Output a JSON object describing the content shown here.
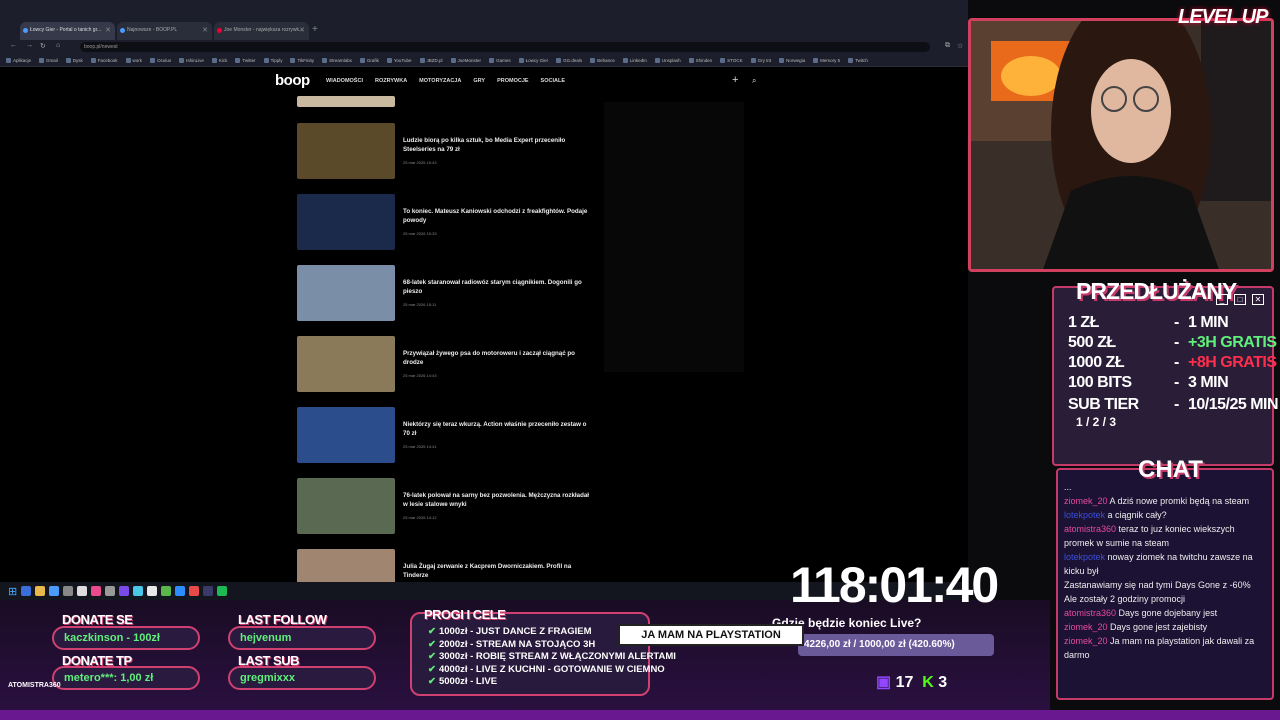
{
  "browser": {
    "tabs": [
      {
        "label": "Łowcy Gier - Portal o tanich gr..."
      },
      {
        "label": "Najnowsze - BOOP.PL"
      },
      {
        "label": "Joe Monster - największa rozrywk..."
      }
    ],
    "url": "boop.pl/newest",
    "bookmarks": [
      "Aplikacje",
      "Gmail",
      "Dysk",
      "Facebook",
      "work",
      "Oculus",
      "IshinLive",
      "Kick",
      "Twitter",
      "Tipply",
      "TikFinity",
      "Streamlabs",
      "Grafik",
      "YouTube",
      "JBZD.pl",
      "JoeMonster",
      "Games",
      "Łowcy Gier",
      "GG.deals",
      "Behance",
      "LinkedIn",
      "Unsplash",
      "Shinden",
      "STOCK",
      "Gry tnt",
      "Norwegia",
      "Memory 5",
      "Twitch"
    ]
  },
  "site": {
    "logo": "boop",
    "nav": [
      "WIADOMOŚCI",
      "ROZRYWKA",
      "MOTORYZACJA",
      "GRY",
      "PROMOCJE",
      "SOCIALE"
    ],
    "articles": [
      {
        "title": "Ludzie biorą po kilka sztuk, bo Media Expert przeceniło Steelseries na 79 zł",
        "date": "25 mar 2026 15:43",
        "thumb_color": "#5a4a2a"
      },
      {
        "title": "To koniec. Mateusz Kaniowski odchodzi z freakfightów. Podaje powody",
        "date": "25 mar 2026 15:33",
        "thumb_color": "#1b2a4a"
      },
      {
        "title": "68-latek staranował radiowóz starym ciągnikiem. Dogonili go pieszo",
        "date": "25 mar 2026 15:11",
        "thumb_color": "#7b8ea8"
      },
      {
        "title": "Przywiązał żywego psa do motoroweru i zaczął ciągnąć po drodze",
        "date": "25 mar 2026 14:43",
        "thumb_color": "#8a7a5a"
      },
      {
        "title": "Niektórzy się teraz wkurzą. Action właśnie przeceniło zestaw o 70 zł",
        "date": "25 mar 2026 14:41",
        "thumb_color": "#2c4d8c"
      },
      {
        "title": "76-latek polował na sarny bez pozwolenia. Mężczyzna rozkładał w lesie stalowe wnyki",
        "date": "25 mar 2026 14:12",
        "thumb_color": "#5a6a52"
      },
      {
        "title": "Julia Żugaj zerwanie z Kacprem Dworniczakiem. Profil na Tinderze",
        "date": "",
        "thumb_color": "#a08670"
      }
    ]
  },
  "overlay": {
    "logo_text": "LEVEL UP",
    "prz_title": "PRZEDŁUŻANY",
    "rules": [
      {
        "left": "1 ZŁ",
        "right": "1 MIN",
        "color": "#ffffff"
      },
      {
        "left": "500 ZŁ",
        "right": "+3H GRATIS",
        "color": "#5ef07a"
      },
      {
        "left": "1000 ZŁ",
        "right": "+8H GRATIS",
        "color": "#ff2e4c"
      },
      {
        "left": "100 BITS",
        "right": "3 MIN",
        "color": "#ffffff"
      },
      {
        "left": "SUB TIER",
        "right": "10/15/25 MIN",
        "color": "#ffffff"
      }
    ],
    "sub_tier_sub": "1 / 2 / 3",
    "chat_title": "CHAT",
    "chat": [
      {
        "user": "",
        "text": "..."
      },
      {
        "user": "ziomek_20",
        "text": "A dziś nowe promki będą na steam"
      },
      {
        "user": "lotekpotek",
        "text": "a ciągnik cały?"
      },
      {
        "user": "atomistra360",
        "text": "teraz to juz koniec wiekszych promek w sumie na steam"
      },
      {
        "user": "lotekpotek",
        "text": "noway ziomek na twitchu zawsze na kicku był"
      },
      {
        "user": "",
        "text": "Zastanawiamy się nad tymi Days Gone z -60%"
      },
      {
        "user": "",
        "text": "Ale zostały 2 godziny promocji"
      },
      {
        "user": "atomistra360",
        "text": "Days gone dojebany jest"
      },
      {
        "user": "ziomek_20",
        "text": "Days gone jest zajebisty"
      },
      {
        "user": "ziomek_20",
        "text": "Ja mam na playstation jak dawali za darmo"
      }
    ],
    "donate_se_label": "DONATE SE",
    "donate_se_value": "kaczkinson - 100zł",
    "donate_tp_label": "DONATE TP",
    "donate_tp_value": "metero***: 1,00 zł",
    "last_follow_label": "LAST FOLLOW",
    "last_follow_value": "hejvenum",
    "last_sub_label": "LAST SUB",
    "last_sub_value": "gregmixxx",
    "goals_label": "PROGI I CELE",
    "goals": [
      "1000zł - JUST DANCE Z FRAGIEM",
      "2000zł - STREAM NA STOJĄCO 3H",
      "3000zł - ROBIĘ STREAM Z WŁĄCZONYMI ALERTAMI",
      "4000zł - LIVE Z KUCHNI - GOTOWANIE W CIEMNO",
      "5000zł - LIVE"
    ],
    "timer": "118:01:40",
    "alert_text": "JA MAM NA PLAYSTATION",
    "question": "Gdzie będzie koniec Live?",
    "progress_text": "4226,00 zł / 1000,00 zł (420.60%)",
    "progress_fraction": 1.0,
    "twitch_count": "17",
    "kick_count": "3",
    "bottom_name": "ATOMISTRA360"
  }
}
